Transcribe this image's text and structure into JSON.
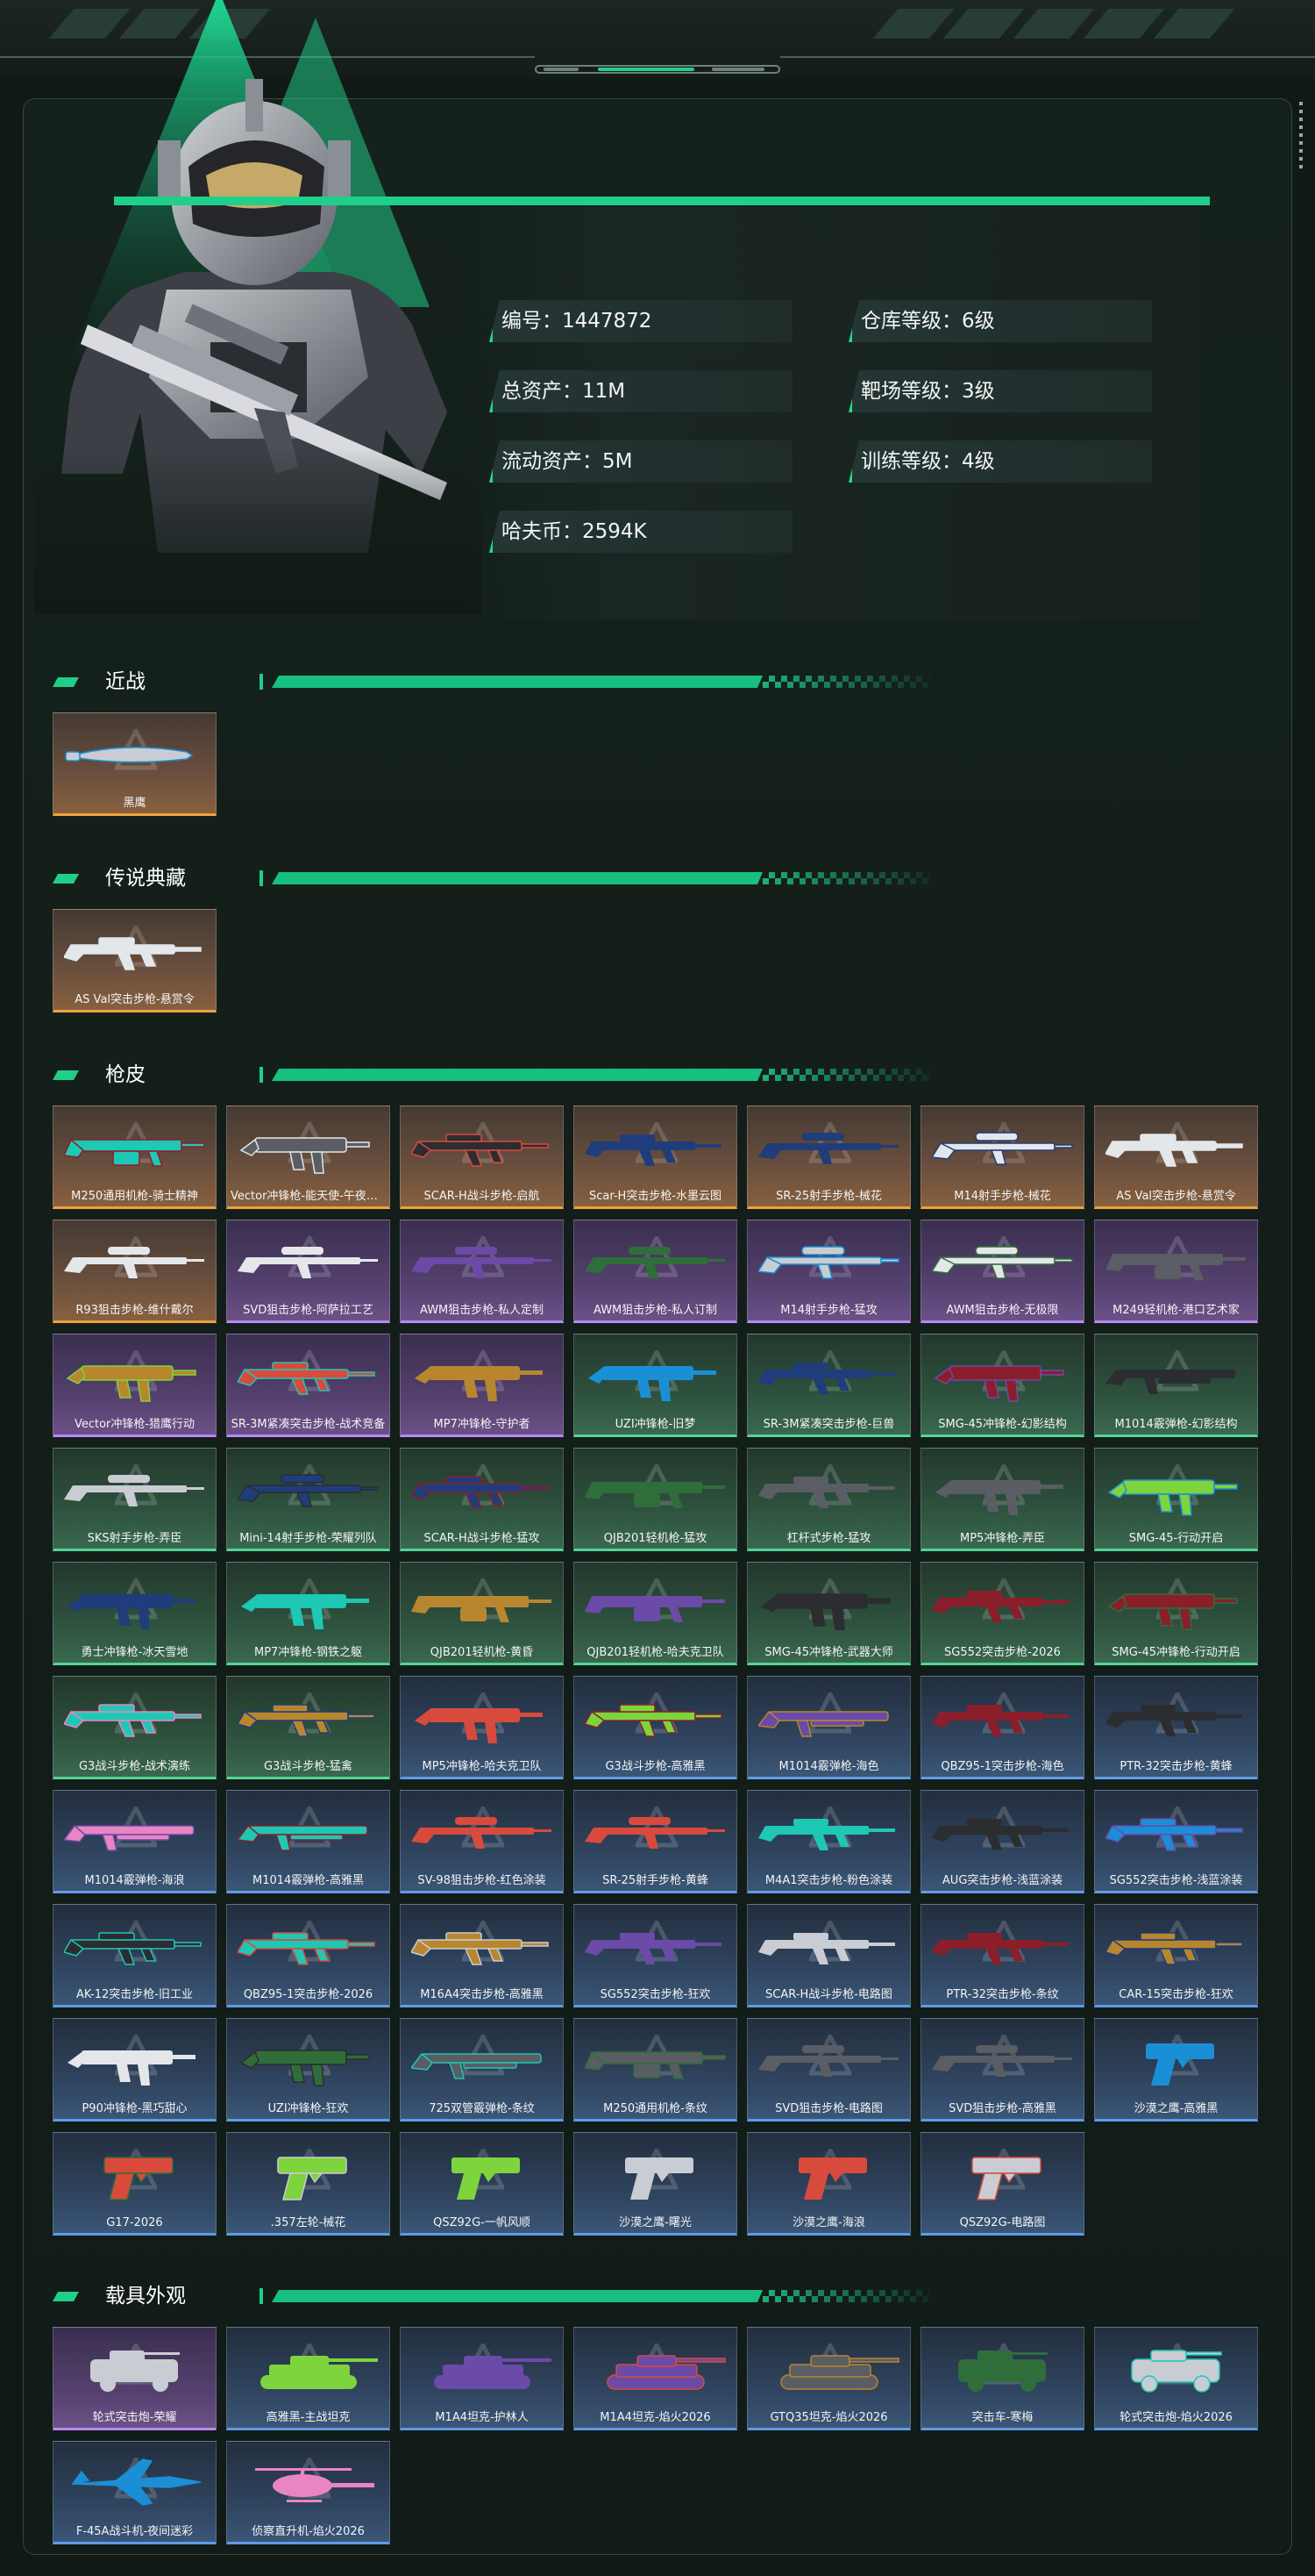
{
  "profile": {
    "id_label": "编号：1447872",
    "total_assets": "总资产：11M",
    "liquid_assets": "流动资产：5M",
    "hafu_coin": "哈夫币：2594K",
    "warehouse_level": "仓库等级：6级",
    "range_level": "靶场等级：3级",
    "training_level": "训练等级：4级"
  },
  "sections": {
    "melee": "近战",
    "legendary": "传说典藏",
    "skins": "枪皮",
    "vehicles": "载具外观"
  },
  "colors": {
    "accent": "#1fcf88",
    "gold": "#f0a23c",
    "purple": "#b889f2",
    "green": "#52d695",
    "blue": "#5f9be6"
  },
  "melee_items": [
    {
      "name": "黑鹰",
      "rarity": "gold",
      "kind": "knife"
    }
  ],
  "legendary_items": [
    {
      "name": "AS Val突击步枪-悬赏令",
      "rarity": "gold",
      "kind": "rifle"
    }
  ],
  "skin_items": [
    {
      "name": "M250通用机枪-骑士精神",
      "rarity": "gold",
      "kind": "lmg"
    },
    {
      "name": "Vector冲锋枪-能天使-午夜邮差",
      "rarity": "gold",
      "kind": "smg"
    },
    {
      "name": "SCAR-H战斗步枪-启航",
      "rarity": "gold",
      "kind": "rifle"
    },
    {
      "name": "Scar-H突击步枪-水墨云图",
      "rarity": "gold",
      "kind": "rifle"
    },
    {
      "name": "SR-25射手步枪-械花",
      "rarity": "gold",
      "kind": "sniper"
    },
    {
      "name": "M14射手步枪-械花",
      "rarity": "gold",
      "kind": "sniper"
    },
    {
      "name": "AS Val突击步枪-悬赏令",
      "rarity": "gold",
      "kind": "rifle"
    },
    {
      "name": "R93狙击步枪-维什戴尔",
      "rarity": "gold",
      "kind": "sniper"
    },
    {
      "name": "SVD狙击步枪-阿萨拉工艺",
      "rarity": "purple",
      "kind": "sniper"
    },
    {
      "name": "AWM狙击步枪-私人定制",
      "rarity": "purple",
      "kind": "sniper"
    },
    {
      "name": "AWM狙击步枪-私人订制",
      "rarity": "purple",
      "kind": "sniper"
    },
    {
      "name": "M14射手步枪-猛攻",
      "rarity": "purple",
      "kind": "sniper"
    },
    {
      "name": "AWM狙击步枪-无极限",
      "rarity": "purple",
      "kind": "sniper"
    },
    {
      "name": "M249轻机枪-港口艺术家",
      "rarity": "purple",
      "kind": "lmg"
    },
    {
      "name": "Vector冲锋枪-猎鹰行动",
      "rarity": "purple",
      "kind": "smg"
    },
    {
      "name": "SR-3M紧凑突击步枪-战术竞备",
      "rarity": "purple",
      "kind": "rifle"
    },
    {
      "name": "MP7冲锋枪-守护者",
      "rarity": "purple",
      "kind": "smg"
    },
    {
      "name": "UZI冲锋枪-旧梦",
      "rarity": "green",
      "kind": "smg"
    },
    {
      "name": "SR-3M紧凑突击步枪-巨兽",
      "rarity": "green",
      "kind": "rifle"
    },
    {
      "name": "SMG-45冲锋枪-幻影结构",
      "rarity": "green",
      "kind": "smg"
    },
    {
      "name": "M1014霰弹枪-幻影结构",
      "rarity": "green",
      "kind": "shotgun"
    },
    {
      "name": "SKS射手步枪-弄臣",
      "rarity": "green",
      "kind": "sniper"
    },
    {
      "name": "Mini-14射手步枪-荣耀列队",
      "rarity": "green",
      "kind": "sniper"
    },
    {
      "name": "SCAR-H战斗步枪-猛攻",
      "rarity": "green",
      "kind": "rifle"
    },
    {
      "name": "QJB201轻机枪-猛攻",
      "rarity": "green",
      "kind": "lmg"
    },
    {
      "name": "杠杆式步枪-猛攻",
      "rarity": "green",
      "kind": "rifle"
    },
    {
      "name": "MP5冲锋枪-弄臣",
      "rarity": "green",
      "kind": "smg"
    },
    {
      "name": "SMG-45-行动开启",
      "rarity": "green",
      "kind": "smg"
    },
    {
      "name": "勇士冲锋枪-冰天雪地",
      "rarity": "green",
      "kind": "smg"
    },
    {
      "name": "MP7冲锋枪-钢铁之躯",
      "rarity": "green",
      "kind": "smg"
    },
    {
      "name": "QJB201轻机枪-黄昏",
      "rarity": "green",
      "kind": "lmg"
    },
    {
      "name": "QJB201轻机枪-哈夫克卫队",
      "rarity": "green",
      "kind": "lmg"
    },
    {
      "name": "SMG-45冲锋枪-武器大师",
      "rarity": "green",
      "kind": "smg"
    },
    {
      "name": "SG552突击步枪-2026",
      "rarity": "green",
      "kind": "rifle"
    },
    {
      "name": "SMG-45冲锋枪-行动开启",
      "rarity": "green",
      "kind": "smg"
    },
    {
      "name": "G3战斗步枪-战术演练",
      "rarity": "green",
      "kind": "rifle"
    },
    {
      "name": "G3战斗步枪-猛禽",
      "rarity": "green",
      "kind": "rifle"
    },
    {
      "name": "MP5冲锋枪-哈夫克卫队",
      "rarity": "blue",
      "kind": "smg"
    },
    {
      "name": "G3战斗步枪-高雅黑",
      "rarity": "blue",
      "kind": "rifle"
    },
    {
      "name": "M1014霰弹枪-海色",
      "rarity": "blue",
      "kind": "shotgun"
    },
    {
      "name": "QBZ95-1突击步枪-海色",
      "rarity": "blue",
      "kind": "rifle"
    },
    {
      "name": "PTR-32突击步枪-黄蜂",
      "rarity": "blue",
      "kind": "rifle"
    },
    {
      "name": "M1014霰弹枪-海浪",
      "rarity": "blue",
      "kind": "shotgun"
    },
    {
      "name": "M1014霰弹枪-高雅黑",
      "rarity": "blue",
      "kind": "shotgun"
    },
    {
      "name": "SV-98狙击步枪-红色涂装",
      "rarity": "blue",
      "kind": "sniper"
    },
    {
      "name": "SR-25射手步枪-黄蜂",
      "rarity": "blue",
      "kind": "sniper"
    },
    {
      "name": "M4A1突击步枪-粉色涂装",
      "rarity": "blue",
      "kind": "rifle"
    },
    {
      "name": "AUG突击步枪-浅蓝涂装",
      "rarity": "blue",
      "kind": "rifle"
    },
    {
      "name": "SG552突击步枪-浅蓝涂装",
      "rarity": "blue",
      "kind": "rifle"
    },
    {
      "name": "AK-12突击步枪-旧工业",
      "rarity": "blue",
      "kind": "rifle"
    },
    {
      "name": "QBZ95-1突击步枪-2026",
      "rarity": "blue",
      "kind": "rifle"
    },
    {
      "name": "M16A4突击步枪-高雅黑",
      "rarity": "blue",
      "kind": "rifle"
    },
    {
      "name": "SG552突击步枪-狂欢",
      "rarity": "blue",
      "kind": "rifle"
    },
    {
      "name": "SCAR-H战斗步枪-电路图",
      "rarity": "blue",
      "kind": "rifle"
    },
    {
      "name": "PTR-32突击步枪-条纹",
      "rarity": "blue",
      "kind": "rifle"
    },
    {
      "name": "CAR-15突击步枪-狂欢",
      "rarity": "blue",
      "kind": "rifle"
    },
    {
      "name": "P90冲锋枪-黑巧甜心",
      "rarity": "blue",
      "kind": "smg"
    },
    {
      "name": "UZI冲锋枪-狂欢",
      "rarity": "blue",
      "kind": "smg"
    },
    {
      "name": "725双管霰弹枪-条纹",
      "rarity": "blue",
      "kind": "shotgun"
    },
    {
      "name": "M250通用机枪-条纹",
      "rarity": "blue",
      "kind": "lmg"
    },
    {
      "name": "SVD狙击步枪-电路图",
      "rarity": "blue",
      "kind": "sniper"
    },
    {
      "name": "SVD狙击步枪-高雅黑",
      "rarity": "blue",
      "kind": "sniper"
    },
    {
      "name": "沙漠之鹰-高雅黑",
      "rarity": "blue",
      "kind": "pistol"
    },
    {
      "name": "G17-2026",
      "rarity": "blue",
      "kind": "pistol"
    },
    {
      "name": ".357左轮-械花",
      "rarity": "blue",
      "kind": "pistol"
    },
    {
      "name": "QSZ92G-一帆风顺",
      "rarity": "blue",
      "kind": "pistol"
    },
    {
      "name": "沙漠之鹰-曙光",
      "rarity": "blue",
      "kind": "pistol"
    },
    {
      "name": "沙漠之鹰-海浪",
      "rarity": "blue",
      "kind": "pistol"
    },
    {
      "name": "QSZ92G-电路图",
      "rarity": "blue",
      "kind": "pistol"
    }
  ],
  "vehicle_items": [
    {
      "name": "轮式突击炮-荣耀",
      "rarity": "purple",
      "kind": "armored-car"
    },
    {
      "name": "高雅黑-主战坦克",
      "rarity": "blue",
      "kind": "tank"
    },
    {
      "name": "M1A4坦克-护林人",
      "rarity": "blue",
      "kind": "tank"
    },
    {
      "name": "M1A4坦克-焰火2026",
      "rarity": "blue",
      "kind": "tank"
    },
    {
      "name": "GTQ35坦克-焰火2026",
      "rarity": "blue",
      "kind": "tank"
    },
    {
      "name": "突击车-寒梅",
      "rarity": "blue",
      "kind": "armored-car"
    },
    {
      "name": "轮式突击炮-焰火2026",
      "rarity": "blue",
      "kind": "armored-car"
    },
    {
      "name": "F-45A战斗机-夜间迷彩",
      "rarity": "blue",
      "kind": "jet"
    },
    {
      "name": "侦察直升机-焰火2026",
      "rarity": "blue",
      "kind": "helicopter"
    }
  ]
}
